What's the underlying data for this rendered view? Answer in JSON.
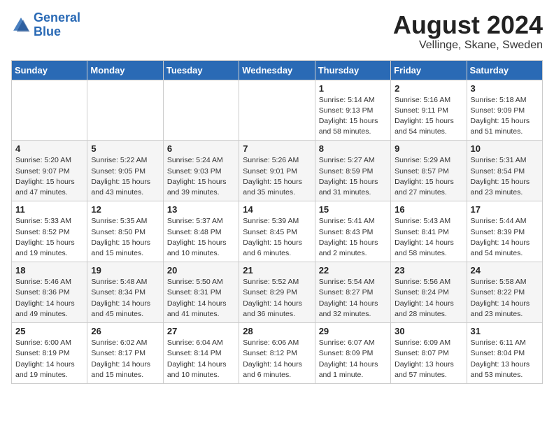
{
  "header": {
    "logo_line1": "General",
    "logo_line2": "Blue",
    "month_year": "August 2024",
    "location": "Vellinge, Skane, Sweden"
  },
  "weekdays": [
    "Sunday",
    "Monday",
    "Tuesday",
    "Wednesday",
    "Thursday",
    "Friday",
    "Saturday"
  ],
  "weeks": [
    [
      {
        "day": "",
        "info": ""
      },
      {
        "day": "",
        "info": ""
      },
      {
        "day": "",
        "info": ""
      },
      {
        "day": "",
        "info": ""
      },
      {
        "day": "1",
        "info": "Sunrise: 5:14 AM\nSunset: 9:13 PM\nDaylight: 15 hours\nand 58 minutes."
      },
      {
        "day": "2",
        "info": "Sunrise: 5:16 AM\nSunset: 9:11 PM\nDaylight: 15 hours\nand 54 minutes."
      },
      {
        "day": "3",
        "info": "Sunrise: 5:18 AM\nSunset: 9:09 PM\nDaylight: 15 hours\nand 51 minutes."
      }
    ],
    [
      {
        "day": "4",
        "info": "Sunrise: 5:20 AM\nSunset: 9:07 PM\nDaylight: 15 hours\nand 47 minutes."
      },
      {
        "day": "5",
        "info": "Sunrise: 5:22 AM\nSunset: 9:05 PM\nDaylight: 15 hours\nand 43 minutes."
      },
      {
        "day": "6",
        "info": "Sunrise: 5:24 AM\nSunset: 9:03 PM\nDaylight: 15 hours\nand 39 minutes."
      },
      {
        "day": "7",
        "info": "Sunrise: 5:26 AM\nSunset: 9:01 PM\nDaylight: 15 hours\nand 35 minutes."
      },
      {
        "day": "8",
        "info": "Sunrise: 5:27 AM\nSunset: 8:59 PM\nDaylight: 15 hours\nand 31 minutes."
      },
      {
        "day": "9",
        "info": "Sunrise: 5:29 AM\nSunset: 8:57 PM\nDaylight: 15 hours\nand 27 minutes."
      },
      {
        "day": "10",
        "info": "Sunrise: 5:31 AM\nSunset: 8:54 PM\nDaylight: 15 hours\nand 23 minutes."
      }
    ],
    [
      {
        "day": "11",
        "info": "Sunrise: 5:33 AM\nSunset: 8:52 PM\nDaylight: 15 hours\nand 19 minutes."
      },
      {
        "day": "12",
        "info": "Sunrise: 5:35 AM\nSunset: 8:50 PM\nDaylight: 15 hours\nand 15 minutes."
      },
      {
        "day": "13",
        "info": "Sunrise: 5:37 AM\nSunset: 8:48 PM\nDaylight: 15 hours\nand 10 minutes."
      },
      {
        "day": "14",
        "info": "Sunrise: 5:39 AM\nSunset: 8:45 PM\nDaylight: 15 hours\nand 6 minutes."
      },
      {
        "day": "15",
        "info": "Sunrise: 5:41 AM\nSunset: 8:43 PM\nDaylight: 15 hours\nand 2 minutes."
      },
      {
        "day": "16",
        "info": "Sunrise: 5:43 AM\nSunset: 8:41 PM\nDaylight: 14 hours\nand 58 minutes."
      },
      {
        "day": "17",
        "info": "Sunrise: 5:44 AM\nSunset: 8:39 PM\nDaylight: 14 hours\nand 54 minutes."
      }
    ],
    [
      {
        "day": "18",
        "info": "Sunrise: 5:46 AM\nSunset: 8:36 PM\nDaylight: 14 hours\nand 49 minutes."
      },
      {
        "day": "19",
        "info": "Sunrise: 5:48 AM\nSunset: 8:34 PM\nDaylight: 14 hours\nand 45 minutes."
      },
      {
        "day": "20",
        "info": "Sunrise: 5:50 AM\nSunset: 8:31 PM\nDaylight: 14 hours\nand 41 minutes."
      },
      {
        "day": "21",
        "info": "Sunrise: 5:52 AM\nSunset: 8:29 PM\nDaylight: 14 hours\nand 36 minutes."
      },
      {
        "day": "22",
        "info": "Sunrise: 5:54 AM\nSunset: 8:27 PM\nDaylight: 14 hours\nand 32 minutes."
      },
      {
        "day": "23",
        "info": "Sunrise: 5:56 AM\nSunset: 8:24 PM\nDaylight: 14 hours\nand 28 minutes."
      },
      {
        "day": "24",
        "info": "Sunrise: 5:58 AM\nSunset: 8:22 PM\nDaylight: 14 hours\nand 23 minutes."
      }
    ],
    [
      {
        "day": "25",
        "info": "Sunrise: 6:00 AM\nSunset: 8:19 PM\nDaylight: 14 hours\nand 19 minutes."
      },
      {
        "day": "26",
        "info": "Sunrise: 6:02 AM\nSunset: 8:17 PM\nDaylight: 14 hours\nand 15 minutes."
      },
      {
        "day": "27",
        "info": "Sunrise: 6:04 AM\nSunset: 8:14 PM\nDaylight: 14 hours\nand 10 minutes."
      },
      {
        "day": "28",
        "info": "Sunrise: 6:06 AM\nSunset: 8:12 PM\nDaylight: 14 hours\nand 6 minutes."
      },
      {
        "day": "29",
        "info": "Sunrise: 6:07 AM\nSunset: 8:09 PM\nDaylight: 14 hours\nand 1 minute."
      },
      {
        "day": "30",
        "info": "Sunrise: 6:09 AM\nSunset: 8:07 PM\nDaylight: 13 hours\nand 57 minutes."
      },
      {
        "day": "31",
        "info": "Sunrise: 6:11 AM\nSunset: 8:04 PM\nDaylight: 13 hours\nand 53 minutes."
      }
    ]
  ]
}
